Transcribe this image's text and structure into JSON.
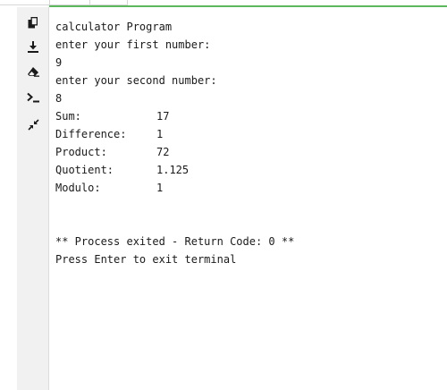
{
  "terminal": {
    "title_line": "calculator Program",
    "prompt_first": "enter your first number:",
    "input_first": "9",
    "prompt_second": "enter your second number:",
    "input_second": "8",
    "results": [
      {
        "label": "Sum:",
        "value": "17"
      },
      {
        "label": "Difference:",
        "value": "1"
      },
      {
        "label": "Product:",
        "value": "72"
      },
      {
        "label": "Quotient:",
        "value": "1.125"
      },
      {
        "label": "Modulo:",
        "value": "1"
      }
    ],
    "exit_message": "** Process exited - Return Code: 0 **",
    "exit_hint": "Press Enter to exit terminal"
  },
  "sidebar": {
    "icons": [
      "copy-icon",
      "download-icon",
      "eraser-icon",
      "terminal-icon",
      "minimize-icon"
    ]
  },
  "colors": {
    "accent": "#5cb85c",
    "sidebar_bg": "#f1f1f1",
    "icon": "#1a1a1a"
  }
}
